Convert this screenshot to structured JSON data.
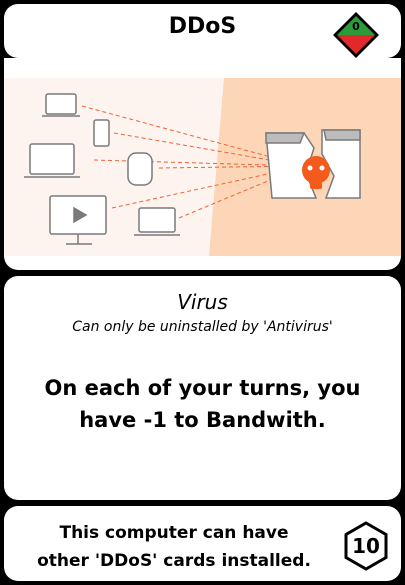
{
  "card": {
    "title": "DDoS",
    "cost": "0",
    "type": "Virus",
    "restriction": "Can only be uninstalled by 'Antivirus'",
    "effect": "On each of your turns, you have -1 to Bandwith.",
    "footer_line1": "This computer can have",
    "footer_line2": "other 'DDoS' cards installed.",
    "value": "10"
  },
  "colors": {
    "art_left_bg": "#fdf3ef",
    "art_right_bg": "#fcd6b6",
    "attack_line": "#f0603a",
    "device_stroke": "#7a7a7a",
    "skull": "#f45a1c",
    "cost_top": "#2e9b3a",
    "cost_bottom": "#e02a2a"
  }
}
